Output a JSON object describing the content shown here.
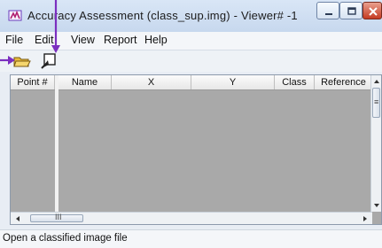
{
  "window": {
    "title": "Accuracy Assessment (class_sup.img) - Viewer# -1"
  },
  "menu": {
    "items": [
      "File",
      "Edit",
      "View",
      "Report",
      "Help"
    ]
  },
  "toolbar": {
    "icons": [
      "open-folder-icon",
      "select-viewer-icon"
    ]
  },
  "table": {
    "columns": [
      "Point #",
      "Name",
      "X",
      "Y",
      "Class",
      "Reference"
    ],
    "rows": []
  },
  "scroll": {
    "h_glyph": "III",
    "v_glyph": "≡"
  },
  "status": {
    "text": "Open a classified image file"
  },
  "colors": {
    "annotation": "#7b2fbf",
    "table_bg": "#a9a9a9"
  }
}
